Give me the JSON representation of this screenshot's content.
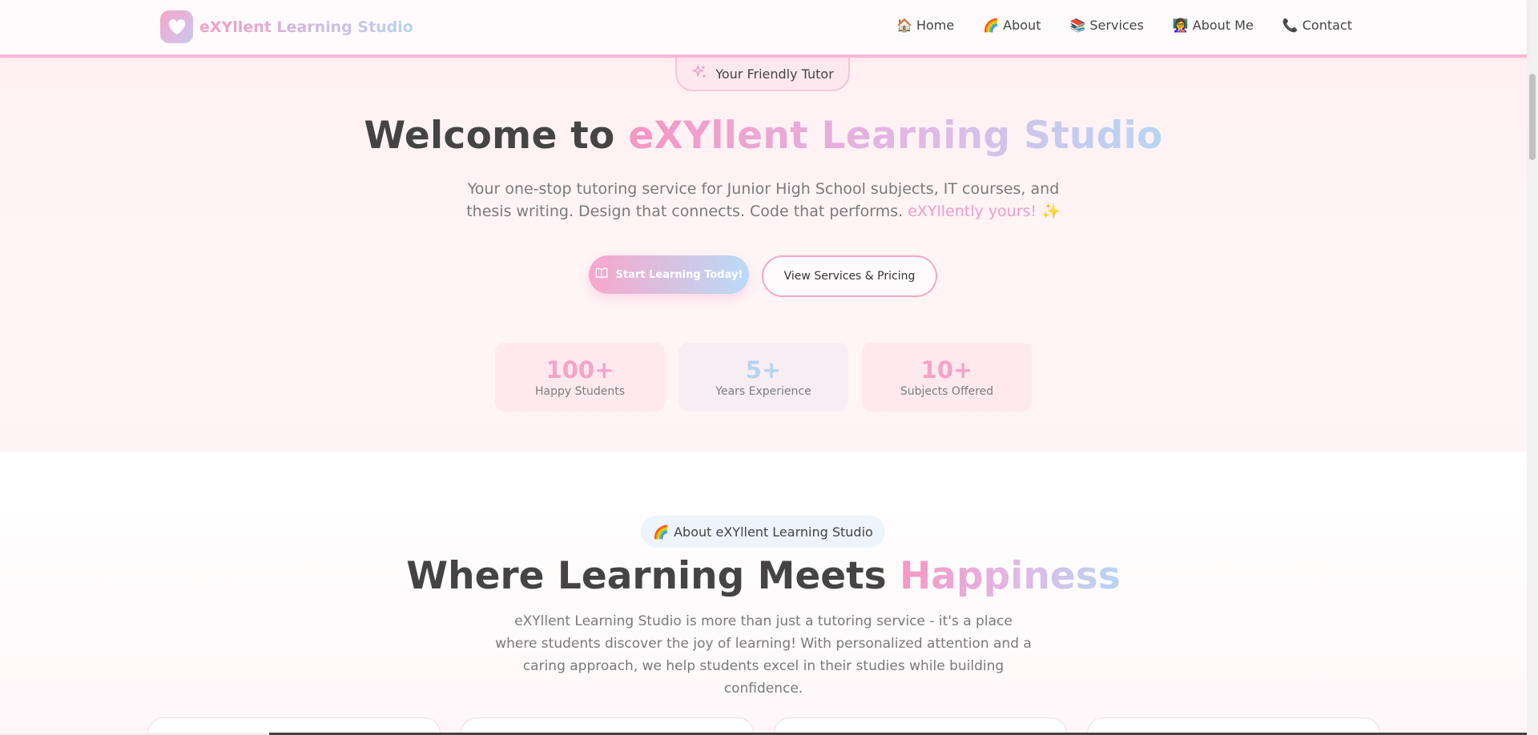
{
  "navbar": {
    "brand": "eXYllent Learning Studio",
    "items": [
      {
        "icon": "🏠",
        "label": "Home"
      },
      {
        "icon": "🌈",
        "label": "About"
      },
      {
        "icon": "📚",
        "label": "Services"
      },
      {
        "icon": "👩‍🏫",
        "label": "About Me"
      },
      {
        "icon": "📞",
        "label": "Contact"
      }
    ]
  },
  "hero": {
    "tag": "Your Friendly Tutor",
    "title_prefix": "Welcome to ",
    "title_highlight": "eXYllent Learning Studio",
    "subtitle": "Your one-stop tutoring service for Junior High School subjects, IT courses, and thesis writing. Design that connects. Code that performs.",
    "subtitle_highlight": "eXYllently yours!",
    "subtitle_emoji": "✨",
    "primary_button": "Start Learning Today!",
    "secondary_button": "View Services & Pricing",
    "stats": [
      {
        "value": "100+",
        "label": "Happy Students"
      },
      {
        "value": "5+",
        "label": "Years Experience"
      },
      {
        "value": "10+",
        "label": "Subjects Offered"
      }
    ]
  },
  "about": {
    "pill_icon": "🌈",
    "pill": "About eXYllent Learning Studio",
    "title_prefix": "Where Learning Meets ",
    "title_highlight": "Happiness",
    "body": "eXYllent Learning Studio is more than just a tutoring service - it's a place where students discover the joy of learning! With personalized attention and a caring approach, we help students excel in their studies while building confidence."
  },
  "colors": {
    "accent_pink": "#f497c3",
    "accent_blue": "#b7d6f2",
    "text": "#444444"
  }
}
